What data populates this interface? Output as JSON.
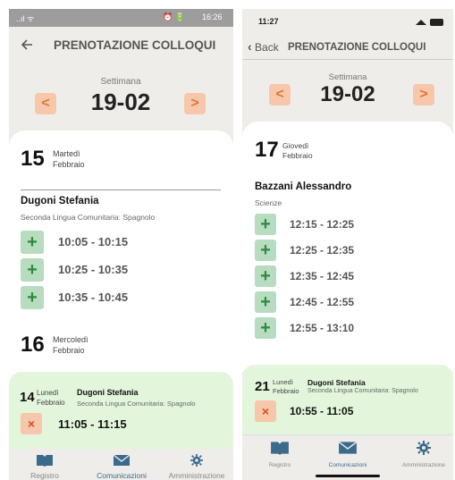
{
  "left": {
    "status": {
      "icons_left": "..ıl ᯤ",
      "icons_right": "⏰ 🔋",
      "time": "16:26"
    },
    "header": {
      "back_icon": "arrow-left-icon",
      "title": "PRENOTAZIONE COLLOQUI"
    },
    "week": {
      "label": "Settimana",
      "value": "19-02",
      "prev": "<",
      "next": ">"
    },
    "days": [
      {
        "num": "15",
        "weekday": "Martedì",
        "month": "Febbraio",
        "teacher": "Dugoni Stefania",
        "subject": "Seconda Lingua Comunitaria: Spagnolo",
        "slots": [
          "10:05 - 10:15",
          "10:25 - 10:35",
          "10:35 - 10:45"
        ]
      },
      {
        "num": "16",
        "weekday": "Mercoledì",
        "month": "Febbraio"
      }
    ],
    "booked": {
      "num": "14",
      "weekday": "Lunedì",
      "month": "Febbraio",
      "teacher": "Dugoni Stefania",
      "subject": "Seconda Lingua Comunitaria: Spagnolo",
      "time": "11:05 - 11:15",
      "cancel": "×"
    },
    "nav": [
      "Registro",
      "Comunicazioni",
      "Amministrazione"
    ]
  },
  "right": {
    "status": {
      "time": "11:27"
    },
    "header": {
      "back": "Back",
      "title": "PRENOTAZIONE COLLOQUI"
    },
    "week": {
      "label": "Settimana",
      "value": "19-02",
      "prev": "<",
      "next": ">"
    },
    "days": [
      {
        "num": "17",
        "weekday": "Giovedì",
        "month": "Febbraio",
        "teacher": "Bazzani Alessandro",
        "subject": "Scienze",
        "slots": [
          "12:15 - 12:25",
          "12:25 - 12:35",
          "12:35 - 12:45",
          "12:45 - 12:55",
          "12:55 - 13:10"
        ]
      }
    ],
    "booked": {
      "num": "21",
      "weekday": "Lunedì",
      "month": "Febbraio",
      "teacher": "Dugoni Stefania",
      "subject": "Seconda Lingua Comunitaria: Spagnolo",
      "time": "10:55 - 11:05",
      "cancel": "×"
    },
    "nav": [
      "Registro",
      "Comunicazioni",
      "Amministrazione"
    ]
  },
  "colors": {
    "accent_orange": "#f6c7ab",
    "accent_green": "#b7dcbf",
    "booked_bg": "#e3f6dc",
    "nav_active": "#3a6a8c"
  }
}
